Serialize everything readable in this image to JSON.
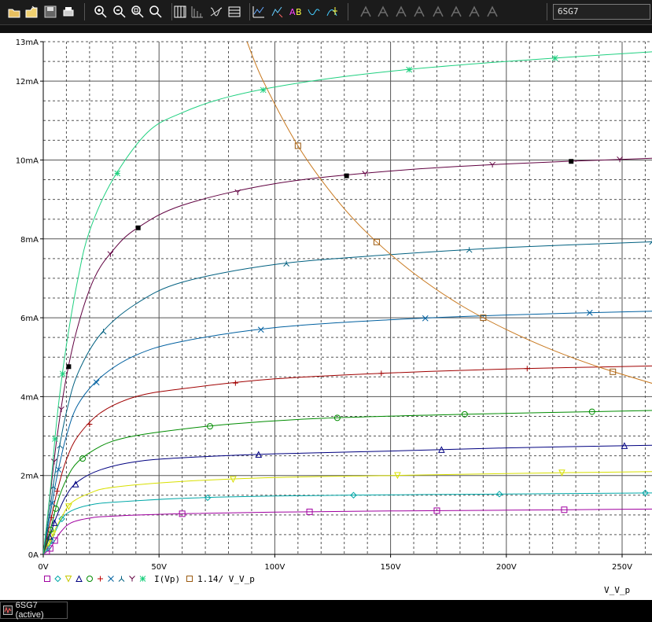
{
  "toolbar": {
    "buttons": [
      {
        "name": "open-folder-icon"
      },
      {
        "name": "open-file-icon"
      },
      {
        "name": "save-icon"
      },
      {
        "name": "print-icon"
      },
      {
        "name": "zoom-in-icon"
      },
      {
        "name": "zoom-out-icon"
      },
      {
        "name": "zoom-area-icon"
      },
      {
        "name": "zoom-fit-icon"
      },
      {
        "name": "toggle-grid-icon"
      },
      {
        "name": "log-x-icon"
      },
      {
        "name": "fourier-icon"
      },
      {
        "name": "axis-settings-icon"
      },
      {
        "name": "add-trace-icon"
      },
      {
        "name": "add-plot-icon"
      },
      {
        "name": "label-icon"
      },
      {
        "name": "mark-data-points-icon"
      },
      {
        "name": "toggle-cursor-icon"
      },
      {
        "name": "cursor-peak-icon"
      },
      {
        "name": "cursor-trough-icon"
      },
      {
        "name": "cursor-slope-icon"
      },
      {
        "name": "cursor-min-icon"
      },
      {
        "name": "cursor-max-icon"
      },
      {
        "name": "cursor-point-icon"
      },
      {
        "name": "cursor-search-icon"
      },
      {
        "name": "cursor-next-icon"
      }
    ],
    "simulation_select": "6SG7"
  },
  "taskbar": {
    "tab_label": "6SG7 (active)"
  },
  "colors": {
    "background": "#ffffff",
    "grid": "#000000",
    "load_line": "#c8781e",
    "toolbar_bg": "#1b1b1b"
  },
  "chart_data": {
    "type": "line",
    "xlabel": "V_V_p",
    "x_ticks": [
      "0V",
      "50V",
      "100V",
      "150V",
      "200V",
      "250V"
    ],
    "y_ticks": [
      "0A",
      "2mA",
      "4mA",
      "6mA",
      "8mA",
      "10mA",
      "12mA",
      "13mA"
    ],
    "xlim": [
      0,
      265
    ],
    "ylim": [
      0,
      13
    ],
    "x_unit": "V",
    "y_unit": "mA",
    "grid": true,
    "legend": {
      "position": "bottom-left",
      "markers": [
        "□",
        "◇",
        "▽",
        "△",
        "○",
        "+",
        "×",
        "⅄",
        "Y",
        "∗"
      ],
      "label_main": "I(Vp)",
      "label_load": "1.14/ V_V_p"
    },
    "series": [
      {
        "marker": "square",
        "color": "#a000a0",
        "points": [
          [
            0,
            0
          ],
          [
            3,
            0.15
          ],
          [
            5,
            0.35
          ],
          [
            8,
            0.6
          ],
          [
            12,
            0.8
          ],
          [
            20,
            0.92
          ],
          [
            30,
            0.97
          ],
          [
            60,
            1.03
          ],
          [
            100,
            1.07
          ],
          [
            150,
            1.1
          ],
          [
            200,
            1.12
          ],
          [
            265,
            1.15
          ]
        ]
      },
      {
        "marker": "diamond",
        "color": "#00a8a8",
        "points": [
          [
            0,
            0
          ],
          [
            3,
            0.25
          ],
          [
            5,
            0.55
          ],
          [
            8,
            0.9
          ],
          [
            12,
            1.1
          ],
          [
            20,
            1.25
          ],
          [
            30,
            1.32
          ],
          [
            60,
            1.42
          ],
          [
            100,
            1.48
          ],
          [
            150,
            1.51
          ],
          [
            200,
            1.53
          ],
          [
            265,
            1.56
          ]
        ]
      },
      {
        "marker": "triangle-down",
        "color": "#d8e000",
        "points": [
          [
            0,
            0
          ],
          [
            4,
            0.5
          ],
          [
            8,
            0.95
          ],
          [
            12,
            1.3
          ],
          [
            20,
            1.55
          ],
          [
            30,
            1.7
          ],
          [
            60,
            1.85
          ],
          [
            100,
            1.95
          ],
          [
            150,
            2.0
          ],
          [
            200,
            2.05
          ],
          [
            265,
            2.1
          ]
        ]
      },
      {
        "marker": "triangle-up",
        "color": "#000080",
        "points": [
          [
            0,
            0
          ],
          [
            3,
            0.5
          ],
          [
            6,
            1.0
          ],
          [
            10,
            1.5
          ],
          [
            15,
            1.85
          ],
          [
            25,
            2.15
          ],
          [
            40,
            2.35
          ],
          [
            60,
            2.45
          ],
          [
            100,
            2.55
          ],
          [
            150,
            2.62
          ],
          [
            200,
            2.7
          ],
          [
            265,
            2.77
          ]
        ]
      },
      {
        "marker": "circle",
        "color": "#008c00",
        "points": [
          [
            0,
            0
          ],
          [
            3,
            0.6
          ],
          [
            6,
            1.3
          ],
          [
            10,
            1.9
          ],
          [
            15,
            2.35
          ],
          [
            25,
            2.75
          ],
          [
            35,
            2.95
          ],
          [
            50,
            3.1
          ],
          [
            80,
            3.3
          ],
          [
            120,
            3.45
          ],
          [
            180,
            3.55
          ],
          [
            265,
            3.65
          ]
        ]
      },
      {
        "marker": "plus",
        "color": "#a00000",
        "points": [
          [
            0,
            0
          ],
          [
            3,
            0.8
          ],
          [
            6,
            1.6
          ],
          [
            10,
            2.4
          ],
          [
            15,
            3.0
          ],
          [
            25,
            3.6
          ],
          [
            40,
            4.0
          ],
          [
            60,
            4.2
          ],
          [
            100,
            4.45
          ],
          [
            150,
            4.6
          ],
          [
            200,
            4.7
          ],
          [
            265,
            4.78
          ]
        ]
      },
      {
        "marker": "cross",
        "color": "#0060a0",
        "points": [
          [
            0,
            0
          ],
          [
            3,
            1.0
          ],
          [
            6,
            2.0
          ],
          [
            10,
            3.0
          ],
          [
            15,
            3.8
          ],
          [
            25,
            4.5
          ],
          [
            40,
            5.05
          ],
          [
            60,
            5.4
          ],
          [
            100,
            5.75
          ],
          [
            150,
            5.95
          ],
          [
            200,
            6.07
          ],
          [
            265,
            6.17
          ]
        ]
      },
      {
        "marker": "tri-stem",
        "color": "#006080",
        "points": [
          [
            0,
            0
          ],
          [
            3,
            1.2
          ],
          [
            6,
            2.4
          ],
          [
            10,
            3.6
          ],
          [
            15,
            4.6
          ],
          [
            25,
            5.6
          ],
          [
            40,
            6.35
          ],
          [
            60,
            6.9
          ],
          [
            100,
            7.35
          ],
          [
            150,
            7.6
          ],
          [
            200,
            7.78
          ],
          [
            265,
            7.93
          ]
        ]
      },
      {
        "marker": "y",
        "color": "#600040",
        "points": [
          [
            0,
            0
          ],
          [
            3,
            1.5
          ],
          [
            6,
            3.0
          ],
          [
            10,
            4.5
          ],
          [
            15,
            5.8
          ],
          [
            22,
            7.0
          ],
          [
            30,
            7.7
          ],
          [
            40,
            8.25
          ],
          [
            60,
            8.85
          ],
          [
            100,
            9.4
          ],
          [
            150,
            9.72
          ],
          [
            200,
            9.9
          ],
          [
            265,
            10.05
          ]
        ]
      },
      {
        "marker": "asterisk",
        "color": "#20d080",
        "points": [
          [
            0,
            0
          ],
          [
            3,
            1.6
          ],
          [
            6,
            3.5
          ],
          [
            10,
            5.3
          ],
          [
            15,
            7.0
          ],
          [
            20,
            8.2
          ],
          [
            30,
            9.5
          ],
          [
            45,
            10.7
          ],
          [
            60,
            11.2
          ],
          [
            80,
            11.6
          ],
          [
            110,
            11.95
          ],
          [
            150,
            12.25
          ],
          [
            200,
            12.5
          ],
          [
            265,
            12.75
          ]
        ]
      }
    ],
    "load_line": {
      "expression": "1.14/ V_V_p",
      "marker": "square",
      "points": [
        [
          88,
          13.0
        ],
        [
          95,
          12.0
        ],
        [
          110,
          10.36
        ],
        [
          125,
          9.12
        ],
        [
          140,
          8.14
        ],
        [
          160,
          7.13
        ],
        [
          180,
          6.33
        ],
        [
          200,
          5.7
        ],
        [
          220,
          5.18
        ],
        [
          240,
          4.75
        ],
        [
          265,
          4.3
        ]
      ],
      "markers_at": [
        [
          110,
          10.36
        ],
        [
          144,
          7.92
        ],
        [
          190,
          6.0
        ],
        [
          246,
          4.63
        ]
      ]
    }
  }
}
